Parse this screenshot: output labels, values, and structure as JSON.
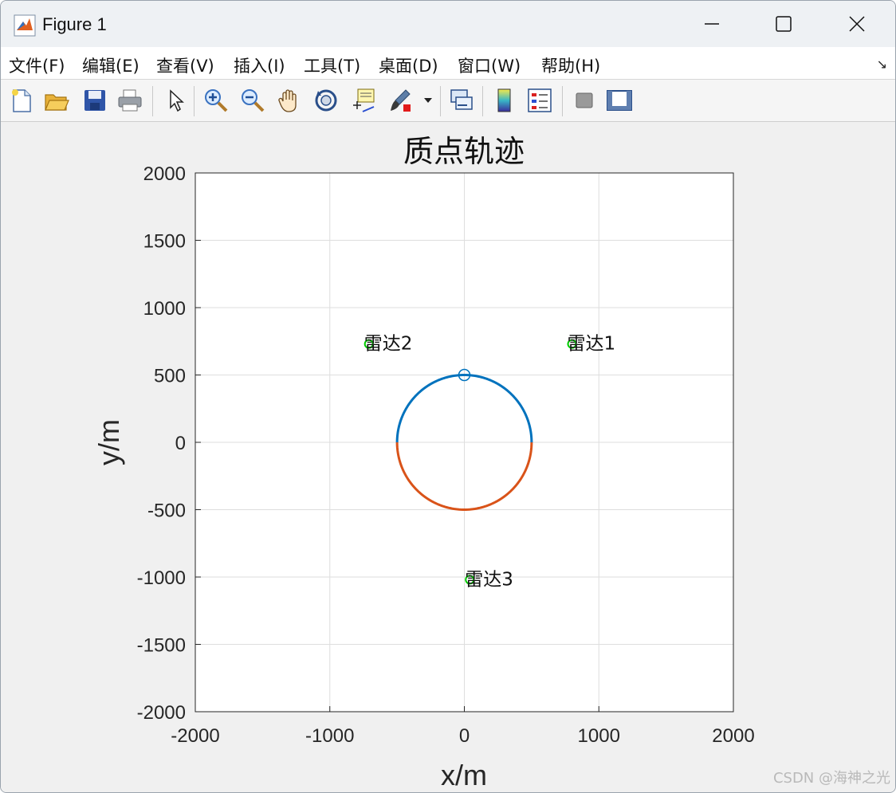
{
  "window": {
    "title": "Figure 1"
  },
  "menu": [
    {
      "label": "文件(F)"
    },
    {
      "label": "编辑(E)"
    },
    {
      "label": "查看(V)"
    },
    {
      "label": "插入(I)"
    },
    {
      "label": "工具(T)"
    },
    {
      "label": "桌面(D)"
    },
    {
      "label": "窗口(W)"
    },
    {
      "label": "帮助(H)"
    }
  ],
  "toolbar": {
    "icons": [
      "new-figure-icon",
      "open-file-icon",
      "save-icon",
      "print-icon",
      "select-arrow-icon",
      "zoom-in-icon",
      "zoom-out-icon",
      "pan-hand-icon",
      "rotate-3d-icon",
      "data-cursor-icon",
      "brush-icon",
      "link-plot-icon",
      "colorbar-icon",
      "legend-icon",
      "hide-plot-tools-icon",
      "show-plot-tools-icon"
    ]
  },
  "chart_data": {
    "type": "line",
    "title": "质点轨迹",
    "xlabel": "x/m",
    "ylabel": "y/m",
    "xlim": [
      -2000,
      2000
    ],
    "ylim": [
      -2000,
      2000
    ],
    "xticks": [
      -2000,
      -1000,
      0,
      1000,
      2000
    ],
    "yticks": [
      2000,
      1500,
      1000,
      500,
      0,
      -500,
      -1000,
      -1500,
      -2000
    ],
    "grid": true,
    "series": [
      {
        "kind": "upper-semicircle",
        "center": [
          0,
          0
        ],
        "radius": 500,
        "color": "#0072BD"
      },
      {
        "kind": "lower-semicircle",
        "center": [
          0,
          0
        ],
        "radius": 500,
        "color": "#D95319"
      },
      {
        "kind": "marker",
        "x": 0,
        "y": 500,
        "color": "#0072BD",
        "marker": "circle"
      }
    ],
    "radars": [
      {
        "label": "雷达1",
        "x": 800,
        "y": 730
      },
      {
        "label": "雷达2",
        "x": -710,
        "y": 730
      },
      {
        "label": "雷达3",
        "x": 40,
        "y": -1020
      }
    ],
    "radar_color": "#00cc00"
  },
  "watermark": "CSDN @海神之光"
}
